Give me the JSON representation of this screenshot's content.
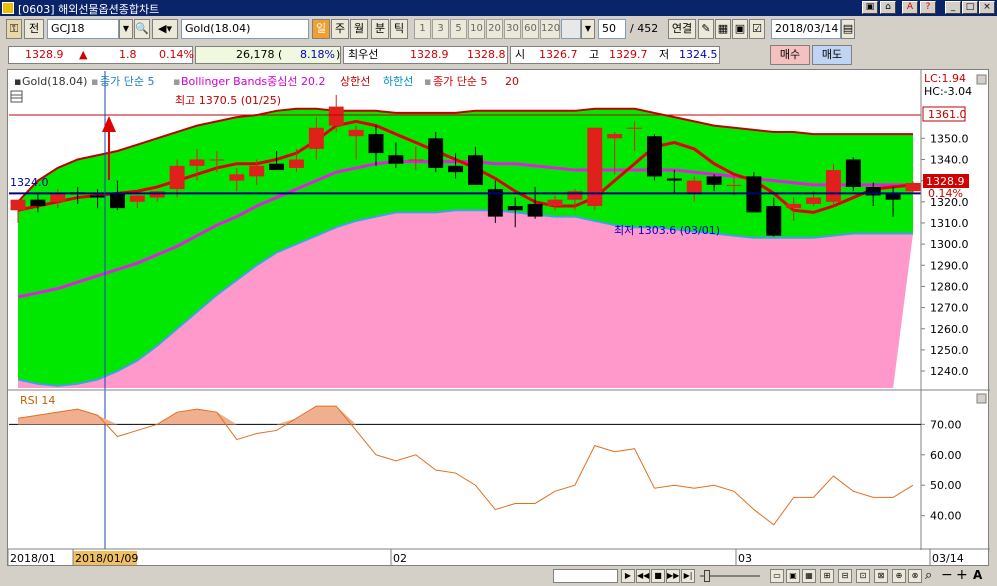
{
  "window": {
    "title": "[0603] 해외선물옵션종합차트",
    "controls": [
      "_",
      "□",
      "×"
    ]
  },
  "toolbar": {
    "prefix_label": "전",
    "symbol": "GCJ18",
    "instrument": "Gold(18.04)",
    "period_buttons": [
      "일",
      "주",
      "월",
      "분",
      "틱"
    ],
    "interval_buttons": [
      "1",
      "3",
      "5",
      "10",
      "20",
      "30",
      "60",
      "120"
    ],
    "count": "50",
    "total": "/ 452",
    "link_button": "연결",
    "date": "2018/03/14"
  },
  "quote": {
    "price": "1328.9",
    "direction": "▲",
    "change": "1.8",
    "change_pct": "0.14%",
    "volume": "26,178 (",
    "volume_pct": "8.18%",
    "volume_close": ")",
    "best_label": "최우선",
    "best_bid": "1328.9",
    "best_ask": "1328.8",
    "open_label": "시",
    "open": "1326.7",
    "high_label": "고",
    "high": "1329.7",
    "low_label": "저",
    "low": "1324.5",
    "buy_button": "매수",
    "sell_button": "매도"
  },
  "legend": {
    "series1": "Gold(18.04)",
    "series2": "종가 단순 5",
    "series3": "Bollinger Bands중심선 20.2",
    "series4": "상한선",
    "series5": "하한선",
    "series6": "종가 단순 5",
    "series6_period": "20"
  },
  "annotations": {
    "high": "최고 1370.5 (01/25)",
    "low": "최저 1303.6 (03/01)",
    "left_price": "1324.0",
    "lc": "LC:1.94",
    "hc": "HC:-3.04",
    "box_top": "1361.0",
    "box_price": "1328.9",
    "box_pct": "0.14%"
  },
  "rsi": {
    "label": "RSI 14"
  },
  "x_axis": {
    "labels": [
      "2018/01",
      "2018/01/09",
      "02",
      "03",
      "03/14"
    ]
  },
  "colors": {
    "up": "#e0201a",
    "down": "#000000",
    "bb_fill": "#00e800",
    "lower_fill": "#ff99cc",
    "ma_red": "#e00000",
    "ma_magenta": "#e020e0"
  },
  "chart_data": {
    "type": "candlestick",
    "price_axis": {
      "ticks": [
        "1350.0",
        "1340.0",
        "1330.0",
        "1320.0",
        "1310.0",
        "1300.0",
        "1290.0",
        "1280.0",
        "1270.0",
        "1260.0",
        "1250.0",
        "1240.0"
      ],
      "ylim": [
        1232,
        1370
      ]
    },
    "rsi_axis": {
      "ticks": [
        "70.00",
        "60.00",
        "50.00",
        "40.00"
      ],
      "ylim": [
        32,
        78
      ]
    },
    "candles": [
      {
        "o": 1316.0,
        "h": 1320.0,
        "l": 1310.0,
        "c": 1321.0
      },
      {
        "o": 1321.0,
        "h": 1324.0,
        "l": 1315.0,
        "c": 1318.0
      },
      {
        "o": 1320.0,
        "h": 1326.0,
        "l": 1317.0,
        "c": 1323.5
      },
      {
        "o": 1324.5,
        "h": 1327.0,
        "l": 1319.0,
        "c": 1323.5
      },
      {
        "o": 1323.0,
        "h": 1326.0,
        "l": 1317.0,
        "c": 1322.0
      },
      {
        "o": 1324.0,
        "h": 1330.0,
        "l": 1316.0,
        "c": 1317.0
      },
      {
        "o": 1320.0,
        "h": 1323.0,
        "l": 1317.0,
        "c": 1323.0
      },
      {
        "o": 1322.0,
        "h": 1325.0,
        "l": 1320.0,
        "c": 1325.0
      },
      {
        "o": 1326.0,
        "h": 1340.0,
        "l": 1322.0,
        "c": 1337.0
      },
      {
        "o": 1337.0,
        "h": 1345.0,
        "l": 1330.0,
        "c": 1340.0
      },
      {
        "o": 1340.0,
        "h": 1344.0,
        "l": 1334.0,
        "c": 1340.0
      },
      {
        "o": 1330.0,
        "h": 1336.0,
        "l": 1325.0,
        "c": 1333.0
      },
      {
        "o": 1332.0,
        "h": 1340.0,
        "l": 1328.0,
        "c": 1337.0
      },
      {
        "o": 1338.0,
        "h": 1344.0,
        "l": 1335.0,
        "c": 1335.0
      },
      {
        "o": 1336.0,
        "h": 1345.0,
        "l": 1334.0,
        "c": 1340.0
      },
      {
        "o": 1345.0,
        "h": 1360.0,
        "l": 1340.0,
        "c": 1355.0
      },
      {
        "o": 1356.0,
        "h": 1370.5,
        "l": 1353.0,
        "c": 1365.0
      },
      {
        "o": 1351.0,
        "h": 1356.0,
        "l": 1340.0,
        "c": 1354.0
      },
      {
        "o": 1352.0,
        "h": 1356.0,
        "l": 1337.0,
        "c": 1343.0
      },
      {
        "o": 1342.0,
        "h": 1348.0,
        "l": 1336.0,
        "c": 1338.0
      },
      {
        "o": 1340.0,
        "h": 1346.0,
        "l": 1335.0,
        "c": 1340.0
      },
      {
        "o": 1350.0,
        "h": 1353.0,
        "l": 1334.0,
        "c": 1336.0
      },
      {
        "o": 1337.0,
        "h": 1343.0,
        "l": 1331.0,
        "c": 1334.0
      },
      {
        "o": 1342.0,
        "h": 1346.0,
        "l": 1328.0,
        "c": 1328.0
      },
      {
        "o": 1326.0,
        "h": 1330.0,
        "l": 1310.0,
        "c": 1313.0
      },
      {
        "o": 1318.0,
        "h": 1322.0,
        "l": 1308.0,
        "c": 1316.0
      },
      {
        "o": 1319.0,
        "h": 1327.0,
        "l": 1312.0,
        "c": 1313.0
      },
      {
        "o": 1318.0,
        "h": 1323.0,
        "l": 1316.0,
        "c": 1321.0
      },
      {
        "o": 1321.0,
        "h": 1326.0,
        "l": 1316.0,
        "c": 1325.0
      },
      {
        "o": 1318.0,
        "h": 1338.0,
        "l": 1316.0,
        "c": 1355.0
      },
      {
        "o": 1350.0,
        "h": 1353.0,
        "l": 1333.0,
        "c": 1352.0
      },
      {
        "o": 1355.0,
        "h": 1358.0,
        "l": 1344.0,
        "c": 1355.0
      },
      {
        "o": 1351.0,
        "h": 1352.0,
        "l": 1330.0,
        "c": 1332.0
      },
      {
        "o": 1331.0,
        "h": 1335.0,
        "l": 1324.0,
        "c": 1330.0
      },
      {
        "o": 1324.0,
        "h": 1332.0,
        "l": 1320.0,
        "c": 1330.0
      },
      {
        "o": 1332.0,
        "h": 1333.0,
        "l": 1325.0,
        "c": 1328.0
      },
      {
        "o": 1328.0,
        "h": 1332.0,
        "l": 1323.0,
        "c": 1328.0
      },
      {
        "o": 1332.0,
        "h": 1334.0,
        "l": 1315.0,
        "c": 1315.0
      },
      {
        "o": 1318.0,
        "h": 1322.0,
        "l": 1303.6,
        "c": 1304.0
      },
      {
        "o": 1317.0,
        "h": 1322.0,
        "l": 1311.0,
        "c": 1319.0
      },
      {
        "o": 1319.0,
        "h": 1325.0,
        "l": 1318.0,
        "c": 1322.0
      },
      {
        "o": 1320.0,
        "h": 1338.0,
        "l": 1318.0,
        "c": 1335.0
      },
      {
        "o": 1340.0,
        "h": 1341.0,
        "l": 1325.0,
        "c": 1327.0
      },
      {
        "o": 1327.0,
        "h": 1329.0,
        "l": 1318.0,
        "c": 1323.0
      },
      {
        "o": 1324.0,
        "h": 1327.0,
        "l": 1313.0,
        "c": 1321.0
      },
      {
        "o": 1325.0,
        "h": 1329.7,
        "l": 1324.5,
        "c": 1328.9
      }
    ],
    "ma5": [
      1316,
      1318,
      1320,
      1322,
      1323,
      1324,
      1325,
      1327,
      1330,
      1333,
      1336,
      1338,
      1338,
      1340,
      1343,
      1349,
      1356,
      1358,
      1356,
      1352,
      1348,
      1344,
      1340,
      1336,
      1331,
      1325,
      1320,
      1318,
      1318,
      1322,
      1330,
      1338,
      1346,
      1348,
      1345,
      1338,
      1333,
      1330,
      1324,
      1316,
      1315,
      1318,
      1322,
      1326,
      1327,
      1328
    ],
    "bb_mid": [
      1275,
      1277,
      1279,
      1282,
      1285,
      1288,
      1291,
      1295,
      1299,
      1304,
      1309,
      1313,
      1318,
      1322,
      1326,
      1330,
      1334,
      1336,
      1338,
      1339,
      1339,
      1339,
      1339,
      1339,
      1338,
      1338,
      1337,
      1336,
      1335,
      1335,
      1335,
      1335,
      1335,
      1335,
      1334,
      1333,
      1332,
      1331,
      1330,
      1329,
      1328,
      1328,
      1328,
      1328,
      1328,
      1328
    ],
    "bb_upper": [
      1320,
      1330,
      1336,
      1340,
      1342,
      1344,
      1347,
      1350,
      1353,
      1356,
      1358,
      1360,
      1361,
      1363,
      1364,
      1364,
      1363,
      1363,
      1363,
      1362,
      1362,
      1362,
      1362,
      1363,
      1363,
      1363,
      1363,
      1363,
      1363,
      1364,
      1364,
      1364,
      1362,
      1360,
      1358,
      1356,
      1355,
      1354,
      1353,
      1353,
      1352,
      1352,
      1352,
      1352,
      1352,
      1352
    ],
    "bb_lower": [
      1236,
      1234,
      1233,
      1234,
      1236,
      1240,
      1245,
      1252,
      1260,
      1268,
      1276,
      1283,
      1290,
      1296,
      1300,
      1304,
      1308,
      1311,
      1313,
      1315,
      1315,
      1315,
      1316,
      1316,
      1316,
      1315,
      1314,
      1313,
      1313,
      1311,
      1309,
      1308,
      1308,
      1307,
      1306,
      1305,
      1304,
      1303,
      1303,
      1303,
      1303,
      1304,
      1305,
      1305,
      1305,
      1305
    ],
    "rsi": [
      72,
      73,
      74,
      75,
      73,
      66,
      68,
      70,
      74,
      75,
      74,
      65,
      67,
      68,
      72,
      76,
      76,
      68,
      60,
      58,
      60,
      55,
      54,
      50,
      42,
      44,
      44,
      48,
      50,
      63,
      61,
      62,
      49,
      50,
      49,
      50,
      48,
      42,
      37,
      46,
      46,
      53,
      48,
      46,
      46,
      50
    ]
  }
}
